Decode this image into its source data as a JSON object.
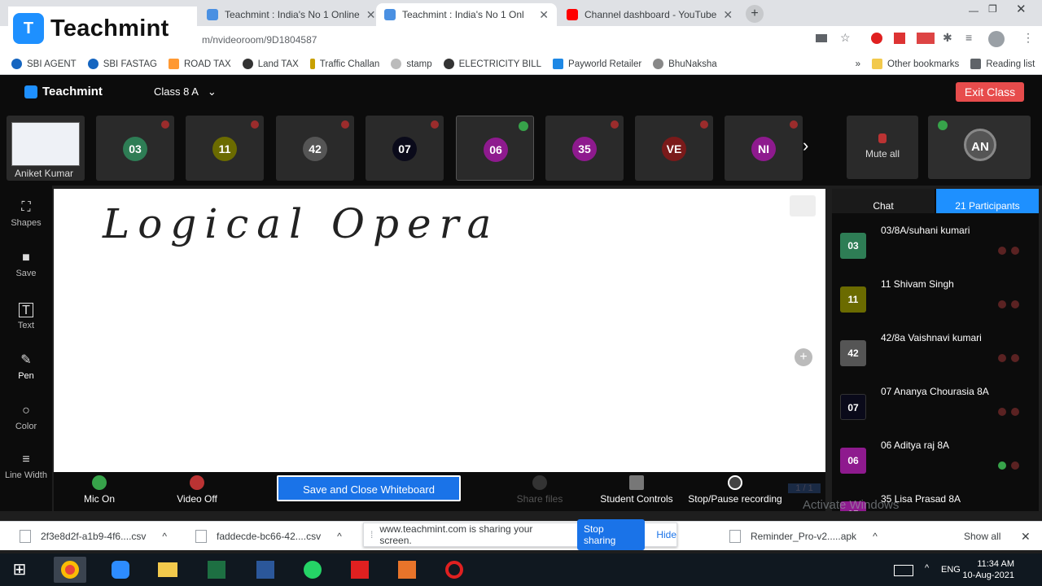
{
  "browser": {
    "tabs": [
      {
        "title": "Teachmint : India's No 1 Online",
        "icon_color": "#4a90e2",
        "active": false
      },
      {
        "title": "Teachmint : India's No 1 Onl",
        "icon_color": "#4a90e2",
        "active": true
      },
      {
        "title": "Channel dashboard - YouTube",
        "icon_color": "#ff0000",
        "active": false
      }
    ],
    "new_tab_label": "+",
    "url": "m/nvideoroom/9D1804587",
    "bookmarks": [
      "SBI AGENT",
      "SBI FASTAG",
      "ROAD TAX",
      "Land TAX",
      "Traffic Challan",
      "stamp",
      "ELECTRICITY BILL",
      "Payworld Retailer",
      "BhuNaksha"
    ],
    "other_bookmarks": "Other bookmarks",
    "reading_list": "Reading list"
  },
  "logo_overlay": {
    "text": "Teachmint",
    "icon": "teachmint-shield-icon"
  },
  "app": {
    "brand": "Teachmint",
    "class_name": "Class 8 A",
    "exit_label": "Exit Class"
  },
  "strip": {
    "self_name": "Aniket Kumar",
    "tiles": [
      {
        "label": "03",
        "color": "#2e7d55",
        "mic": "off"
      },
      {
        "label": "11",
        "color": "#6b6b00",
        "mic": "off"
      },
      {
        "label": "42",
        "color": "#555555",
        "mic": "off"
      },
      {
        "label": "07",
        "color": "#0a0a1a",
        "mic": "off"
      },
      {
        "label": "06",
        "color": "#8e1a8e",
        "mic": "on"
      },
      {
        "label": "35",
        "color": "#8e1a8e",
        "mic": "off"
      },
      {
        "label": "VE",
        "color": "#7a1a1a",
        "mic": "off"
      },
      {
        "label": "NI",
        "color": "#8e1a8e",
        "mic": "off"
      }
    ],
    "mute_all": "Mute all",
    "host_initials": "AN"
  },
  "tools": [
    {
      "name": "shapes",
      "label": "Shapes",
      "glyph": "⛶"
    },
    {
      "name": "save",
      "label": "Save",
      "glyph": "■"
    },
    {
      "name": "text",
      "label": "Text",
      "glyph": "T"
    },
    {
      "name": "pen",
      "label": "Pen",
      "glyph": "✎"
    },
    {
      "name": "color",
      "label": "Color",
      "glyph": "○"
    },
    {
      "name": "line-width",
      "label": "Line Width",
      "glyph": "≡"
    }
  ],
  "board": {
    "handwriting": "Logical Opera"
  },
  "controls": {
    "mic": "Mic On",
    "video": "Video Off",
    "save_close": "Save and Close Whiteboard",
    "share_files": "Share files",
    "student_controls": "Student Controls",
    "recording": "Stop/Pause recording",
    "page": "1 / 1"
  },
  "panel": {
    "chat_tab": "Chat",
    "participants_tab": "21 Participants",
    "participants": [
      {
        "badge": "03",
        "name": "03/8A/suhani kumari",
        "color": "#2e7d55",
        "mic": "off"
      },
      {
        "badge": "11",
        "name": "11 Shivam Singh",
        "color": "#6b6b00",
        "mic": "off"
      },
      {
        "badge": "42",
        "name": "42/8a Vaishnavi kumari",
        "color": "#555555",
        "mic": "off"
      },
      {
        "badge": "07",
        "name": "07 Ananya Chourasia 8A",
        "color": "#0a0a1a",
        "mic": "off"
      },
      {
        "badge": "06",
        "name": "06 Aditya raj 8A",
        "color": "#8e1a8e",
        "mic": "on"
      },
      {
        "badge": "35",
        "name": "35 Lisa Prasad 8A",
        "color": "#8e1a8e",
        "mic": "off"
      }
    ],
    "watermark": "Activate Windows"
  },
  "downloads": {
    "items": [
      "2f3e8d2f-a1b9-4f6....csv",
      "faddecde-bc66-42....csv",
      "Reminder_Pro-v2.....apk"
    ],
    "sharing_text": "www.teachmint.com is sharing your screen.",
    "stop_sharing": "Stop sharing",
    "hide": "Hide",
    "show_all": "Show all"
  },
  "taskbar": {
    "lang": "ENG",
    "time": "11:34 AM",
    "date": "10-Aug-2021"
  }
}
